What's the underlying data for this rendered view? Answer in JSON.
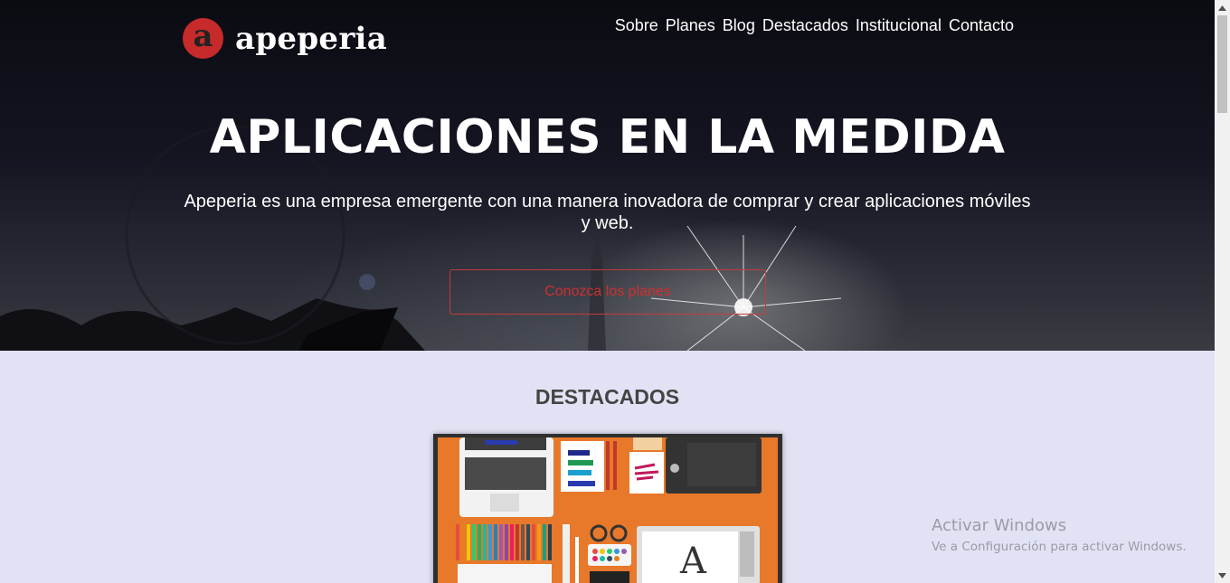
{
  "brand": {
    "logo_letter": "a",
    "name": "apeperia",
    "accent": "#c62a2a"
  },
  "nav": {
    "items": [
      "Sobre",
      "Planes",
      "Blog",
      "Destacados",
      "Institucional",
      "Contacto"
    ]
  },
  "hero": {
    "title": "APLICACIONES EN LA MEDIDA",
    "subtitle": "Apeperia es una empresa emergente con una manera inovadora de comprar y crear aplicaciones móviles y web.",
    "cta_label": "Conozca los planes"
  },
  "featured": {
    "title": "DESTACADOS"
  },
  "watermark": {
    "title": "Activar Windows",
    "subtitle": "Ve a Configuración para activar Windows."
  },
  "colors": {
    "section_bg": "#e1e3f5",
    "cta": "#d02f2f",
    "featured_bg": "#e8782a"
  }
}
